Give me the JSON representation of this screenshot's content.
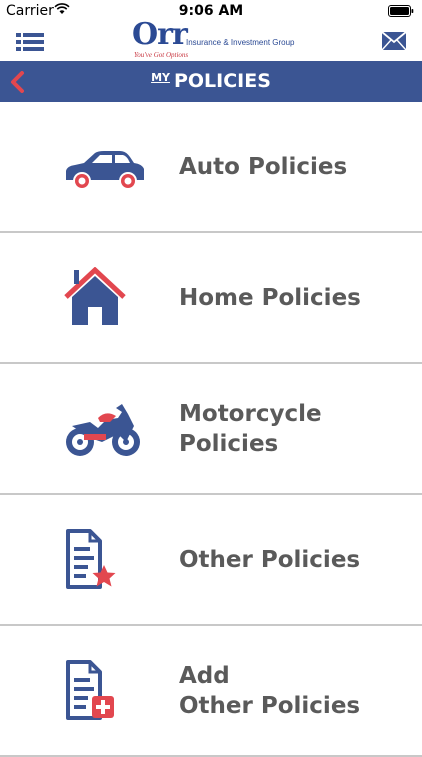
{
  "status_bar": {
    "carrier": "Carrier",
    "time": "9:06 AM"
  },
  "header": {
    "logo": {
      "name": "Orr",
      "subtitle": "Insurance & Investment Group",
      "tagline": "You've Got Options"
    },
    "menu_icon": "hamburger-icon",
    "mail_icon": "envelope-icon"
  },
  "title_bar": {
    "prefix": "MY",
    "title": "POLICIES",
    "back_icon": "chevron-left-icon"
  },
  "items": [
    {
      "label": "Auto Policies",
      "icon": "car-icon"
    },
    {
      "label": "Home Policies",
      "icon": "house-icon"
    },
    {
      "label": "Motorcycle\nPolicies",
      "icon": "motorcycle-icon"
    },
    {
      "label": "Other Policies",
      "icon": "document-star-icon"
    },
    {
      "label": "Add\nOther Policies",
      "icon": "document-add-icon"
    }
  ],
  "colors": {
    "brand_blue": "#3b5593",
    "accent_red": "#e2474f",
    "label_gray": "#5a5a5a",
    "divider": "#c8c8c8"
  }
}
